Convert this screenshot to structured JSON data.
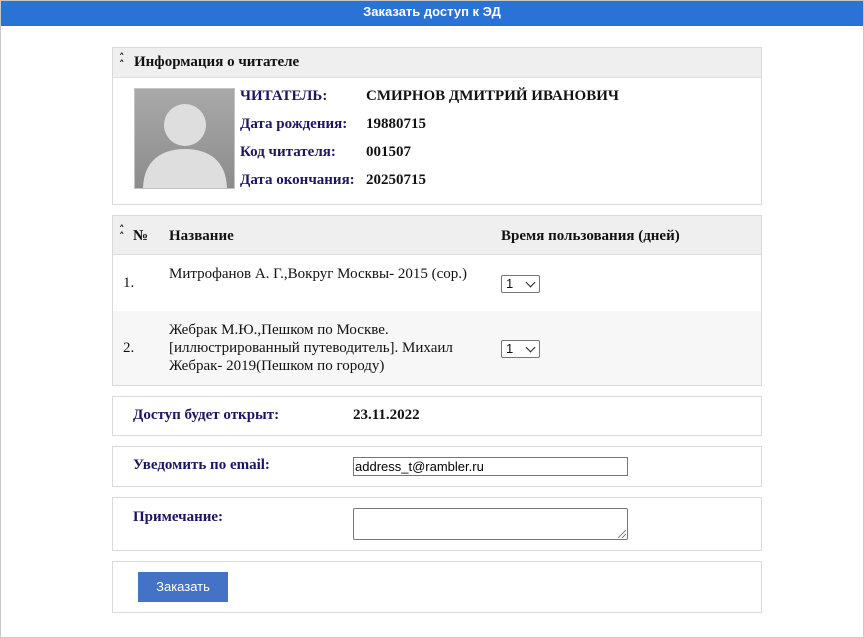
{
  "window": {
    "title": "Заказать доступ к ЭД"
  },
  "reader_panel": {
    "title": "Информация о читателе",
    "fields": [
      {
        "label": "ЧИТАТЕЛЬ:",
        "value": "СМИРНОВ ДМИТРИЙ ИВАНОВИЧ"
      },
      {
        "label": "Дата рождения:",
        "value": "19880715"
      },
      {
        "label": "Код читателя:",
        "value": "001507"
      },
      {
        "label": "Дата окончания:",
        "value": "20250715"
      }
    ]
  },
  "items_table": {
    "columns": [
      "№",
      "Название",
      "Время пользования (дней)"
    ],
    "rows": [
      {
        "num": "1.",
        "title": "Митрофанов А. Г.,Вокруг Москвы- 2015 (сор.)",
        "days": "1"
      },
      {
        "num": "2.",
        "title": "Жебрак М.Ю.,Пешком по Москве. [иллюстрированный путеводитель]. Михаил Жебрак- 2019(Пешком по городу)",
        "days": "1"
      }
    ]
  },
  "access": {
    "label": "Доступ будет открыт:",
    "date": "23.11.2022"
  },
  "email": {
    "label": "Уведомить по email:",
    "value": "address_t@rambler.ru"
  },
  "note": {
    "label": "Примечание:",
    "value": ""
  },
  "submit": {
    "label": "Заказать"
  },
  "icons": {
    "collapse": "chevron-up-icon",
    "avatar": "user-placeholder-icon"
  },
  "colors": {
    "titlebar": "#2a72d6",
    "label": "#1c1660",
    "button": "#4472c4"
  }
}
